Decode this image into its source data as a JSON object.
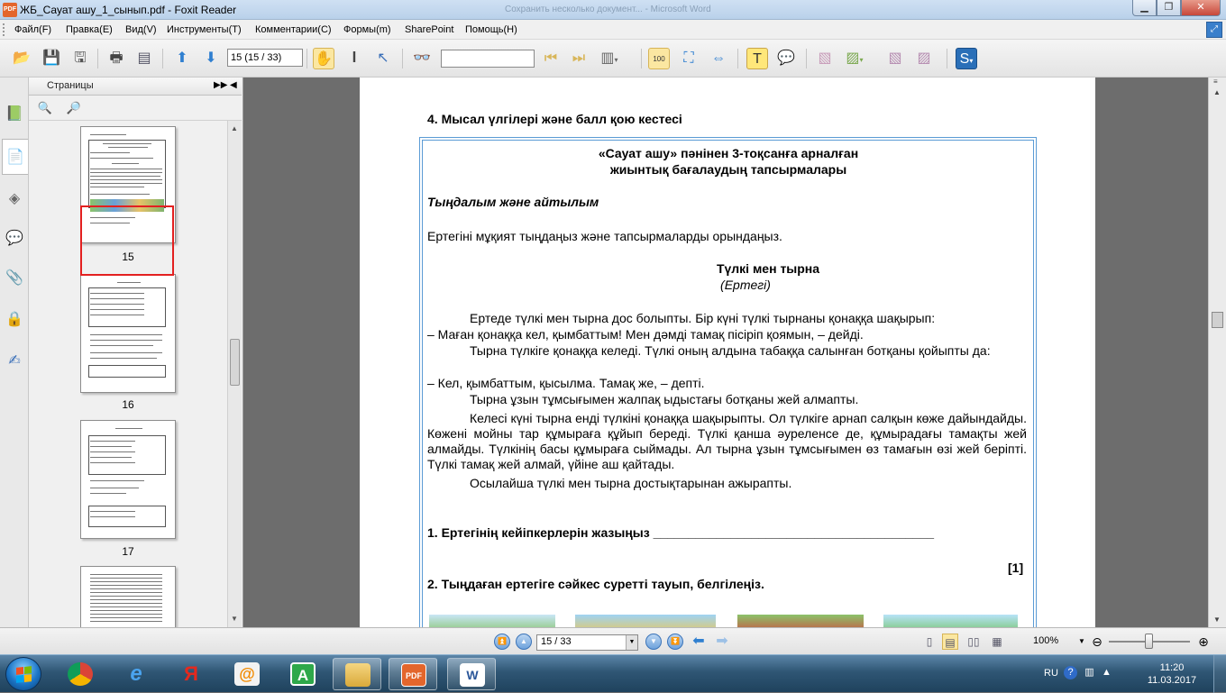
{
  "window": {
    "title": "ЖБ_Сауат ашу_1_сынып.pdf - Foxit Reader",
    "background_title": "Сохранить несколько документ... - Microsoft Word",
    "app_icon_text": "PDF"
  },
  "menu": {
    "items": [
      "Файл(F)",
      "Правка(E)",
      "Вид(V)",
      "Инструменты(T)",
      "Комментарии(C)",
      "Формы(m)",
      "SharePoint",
      "Помощь(H)"
    ]
  },
  "toolbar": {
    "page_input_value": "15 (15 / 33)",
    "search_value": "",
    "zoom_badge": "100"
  },
  "sidebar": {
    "pane_title": "Страницы",
    "thumbnails": [
      {
        "label": "15"
      },
      {
        "label": "16"
      },
      {
        "label": "17"
      }
    ]
  },
  "document": {
    "section_heading": "4. Мысал үлгілері және балл қою кестесі",
    "frame_title_line1": "«Сауат ашу» пәнінен 3-тоқсанға арналған",
    "frame_title_line2": "жиынтық бағалаудың тапсырмалары",
    "subheading": "Тыңдалым және айтылым",
    "instruction": "Ертегіні мұқият тыңдаңыз және тапсырмаларды орындаңыз.",
    "story_title": "Түлкі мен тырна",
    "story_subtitle": "(Ертегі)",
    "story_lines": [
      "Ертеде түлкі мен тырна дос болыпты. Бір күні түлкі тырнаны қонаққа шақырып:",
      "– Маған қонаққа кел, қымбаттым! Мен дәмді тамақ пісіріп қоямын, – дейді.",
      "Тырна түлкіге қонаққа келеді. Түлкі оның алдына табаққа салынған ботқаны қойыпты да:",
      "– Кел, қымбаттым, қысылма. Тамақ же, – депті.",
      "Тырна ұзын тұмсығымен  жалпақ ыдыстағы ботқаны жей алмапты.",
      "Келесі күні тырна енді түлкіні қонаққа шақырыпты. Ол түлкіге арнап салқын көже дайындайды. Көжені мойны тар құмыраға құйып береді. Түлкі қанша әуреленсе де, құмырадағы тамақты жей алмайды. Түлкінің басы құмыраға сыймады. Ал тырна ұзын тұмсығымен өз тамағын өзі жей беріпті. Түлкі тамақ жей алмай, үйіне аш қайтады.",
      "Осылайша түлкі мен тырна достықтарынан ажырапты."
    ],
    "task1": "1. Ертегінің кейіпкерлерін жазыңыз ________________________________________",
    "task1_score": "[1]",
    "task2": "2. Тыңдаған ертегіге сәйкес суретті тауып, белгілеңіз."
  },
  "statusbar": {
    "page_value": "15 / 33",
    "zoom": "100%"
  },
  "taskbar": {
    "yandex_glyph": "Я",
    "agent_glyph": "@",
    "a_glyph": "A",
    "pdf_glyph": "PDF",
    "word_glyph": "W",
    "lang": "RU",
    "time": "11:20",
    "date": "11.03.2017"
  },
  "colors": {
    "selection_red": "#e32020",
    "frame_blue": "#5b9bd5",
    "background_gray": "#6d6d6d"
  }
}
